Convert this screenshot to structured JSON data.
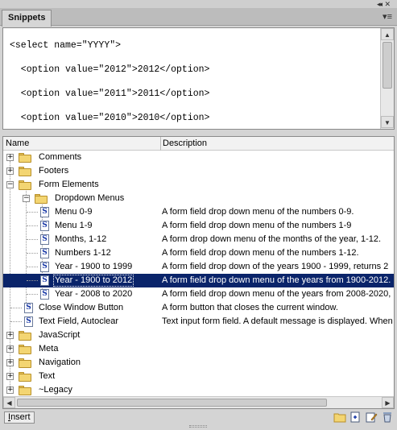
{
  "panel": {
    "tab_label": "Snippets",
    "collapse_glyph": "◂◂",
    "close_glyph": "✕",
    "menu_glyph": "▾≡"
  },
  "preview": {
    "lines": [
      "<select name=\"YYYY\">",
      "  <option value=\"2012\">2012</option>",
      "  <option value=\"2011\">2011</option>",
      "  <option value=\"2010\">2010</option>"
    ]
  },
  "list": {
    "columns": {
      "name": "Name",
      "description": "Description"
    },
    "rows": [
      {
        "name": "Comments",
        "desc": "",
        "kind": "folder",
        "expanded": false
      },
      {
        "name": "Footers",
        "desc": "",
        "kind": "folder",
        "expanded": false
      },
      {
        "name": "Form Elements",
        "desc": "",
        "kind": "folder",
        "expanded": true
      },
      {
        "name": "Dropdown Menus",
        "desc": "",
        "kind": "folder",
        "expanded": true
      },
      {
        "name": "Menu 0-9",
        "desc": "A form field drop down menu of the numbers 0-9.",
        "kind": "snippet"
      },
      {
        "name": "Menu 1-9",
        "desc": "A form field drop down menu of the numbers 1-9",
        "kind": "snippet"
      },
      {
        "name": "Months, 1-12",
        "desc": "A form drop down menu of the months of the year, 1-12.",
        "kind": "snippet"
      },
      {
        "name": "Numbers 1-12",
        "desc": "A form field drop down menu of the numbers 1-12.",
        "kind": "snippet"
      },
      {
        "name": "Year - 1900 to 1999",
        "desc": "A form field drop down of the years 1900 - 1999, returns 2",
        "kind": "snippet"
      },
      {
        "name": "Year - 1900 to 2012",
        "desc": "A form field drop down menu of the years from 1900-2012.",
        "kind": "snippet",
        "selected": true
      },
      {
        "name": "Year - 2008 to 2020",
        "desc": "A form field drop down menu of the years from 2008-2020,",
        "kind": "snippet"
      },
      {
        "name": "Close Window Button",
        "desc": "A form button that closes the current window.",
        "kind": "snippet"
      },
      {
        "name": "Text Field, Autoclear",
        "desc": "Text input form field. A default message is displayed. When",
        "kind": "snippet"
      },
      {
        "name": "JavaScript",
        "desc": "",
        "kind": "folder",
        "expanded": false
      },
      {
        "name": "Meta",
        "desc": "",
        "kind": "folder",
        "expanded": false
      },
      {
        "name": "Navigation",
        "desc": "",
        "kind": "folder",
        "expanded": false
      },
      {
        "name": "Text",
        "desc": "",
        "kind": "folder",
        "expanded": false
      },
      {
        "name": "~Legacy",
        "desc": "",
        "kind": "folder",
        "expanded": false
      }
    ]
  },
  "toolbar": {
    "insert_label": "Insert",
    "icons": [
      "new-folder-icon",
      "new-snippet-icon",
      "edit-snippet-icon",
      "delete-icon"
    ]
  },
  "colors": {
    "selection": "#0a246a",
    "folder": "#f3d572"
  }
}
